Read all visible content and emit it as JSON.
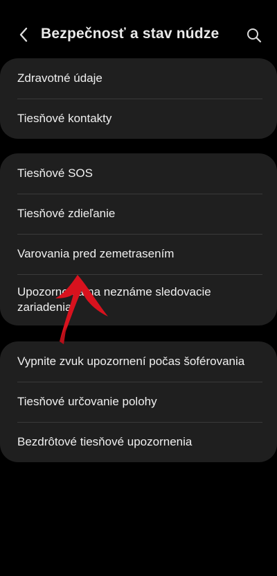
{
  "header": {
    "title": "Bezpečnosť a stav núdze"
  },
  "groups": [
    {
      "items": [
        {
          "label": "Zdravotné údaje"
        },
        {
          "label": "Tiesňové kontakty"
        }
      ]
    },
    {
      "items": [
        {
          "label": "Tiesňové SOS"
        },
        {
          "label": "Tiesňové zdieľanie"
        },
        {
          "label": "Varovania pred zemetrasením"
        },
        {
          "label": "Upozornenia na neznáme sledovacie zariadenia"
        }
      ]
    },
    {
      "items": [
        {
          "label": "Vypnite zvuk upozornení počas šoférovania"
        },
        {
          "label": "Tiesňové určovanie polohy"
        },
        {
          "label": "Bezdrôtové tiesňové upozornenia"
        }
      ]
    }
  ],
  "icons": {
    "back": "chevron-left-icon",
    "search": "search-icon"
  },
  "colors": {
    "background": "#000000",
    "card": "#1f1f1f",
    "divider": "#3a3a3a",
    "annotation_arrow": "#d8121e"
  }
}
